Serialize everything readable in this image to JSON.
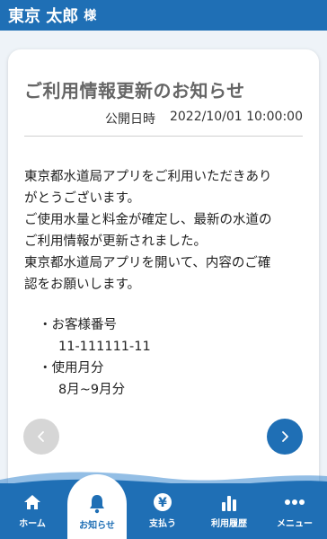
{
  "header": {
    "user_name": "東京 太郎",
    "honorific": "様"
  },
  "notice": {
    "title": "ご利用情報更新のお知らせ",
    "published_label": "公開日時",
    "published_at": "2022/10/01 10:00:00",
    "body_lines": [
      "東京都水道局アプリをご利用いただきあり",
      "がとうございます。",
      "ご使用水量と料金が確定し、最新の水道の",
      "ご利用情報が更新されました。",
      "東京都水道局アプリを開いて、内容のご確",
      "認をお願いします。"
    ],
    "customer_number_label": "・お客様番号",
    "customer_number": "11-111111-11",
    "usage_month_label": "・使用月分",
    "usage_month": "8月~9月分"
  },
  "nav": {
    "prev_icon": "chevron-left-icon",
    "next_icon": "chevron-right-icon"
  },
  "tabs": {
    "home": "ホーム",
    "notice": "お知らせ",
    "payment": "支払う",
    "history": "利用履歴",
    "menu": "メニュー"
  },
  "colors": {
    "brand": "#1f6fb5",
    "disabled": "#d6d6d6"
  }
}
